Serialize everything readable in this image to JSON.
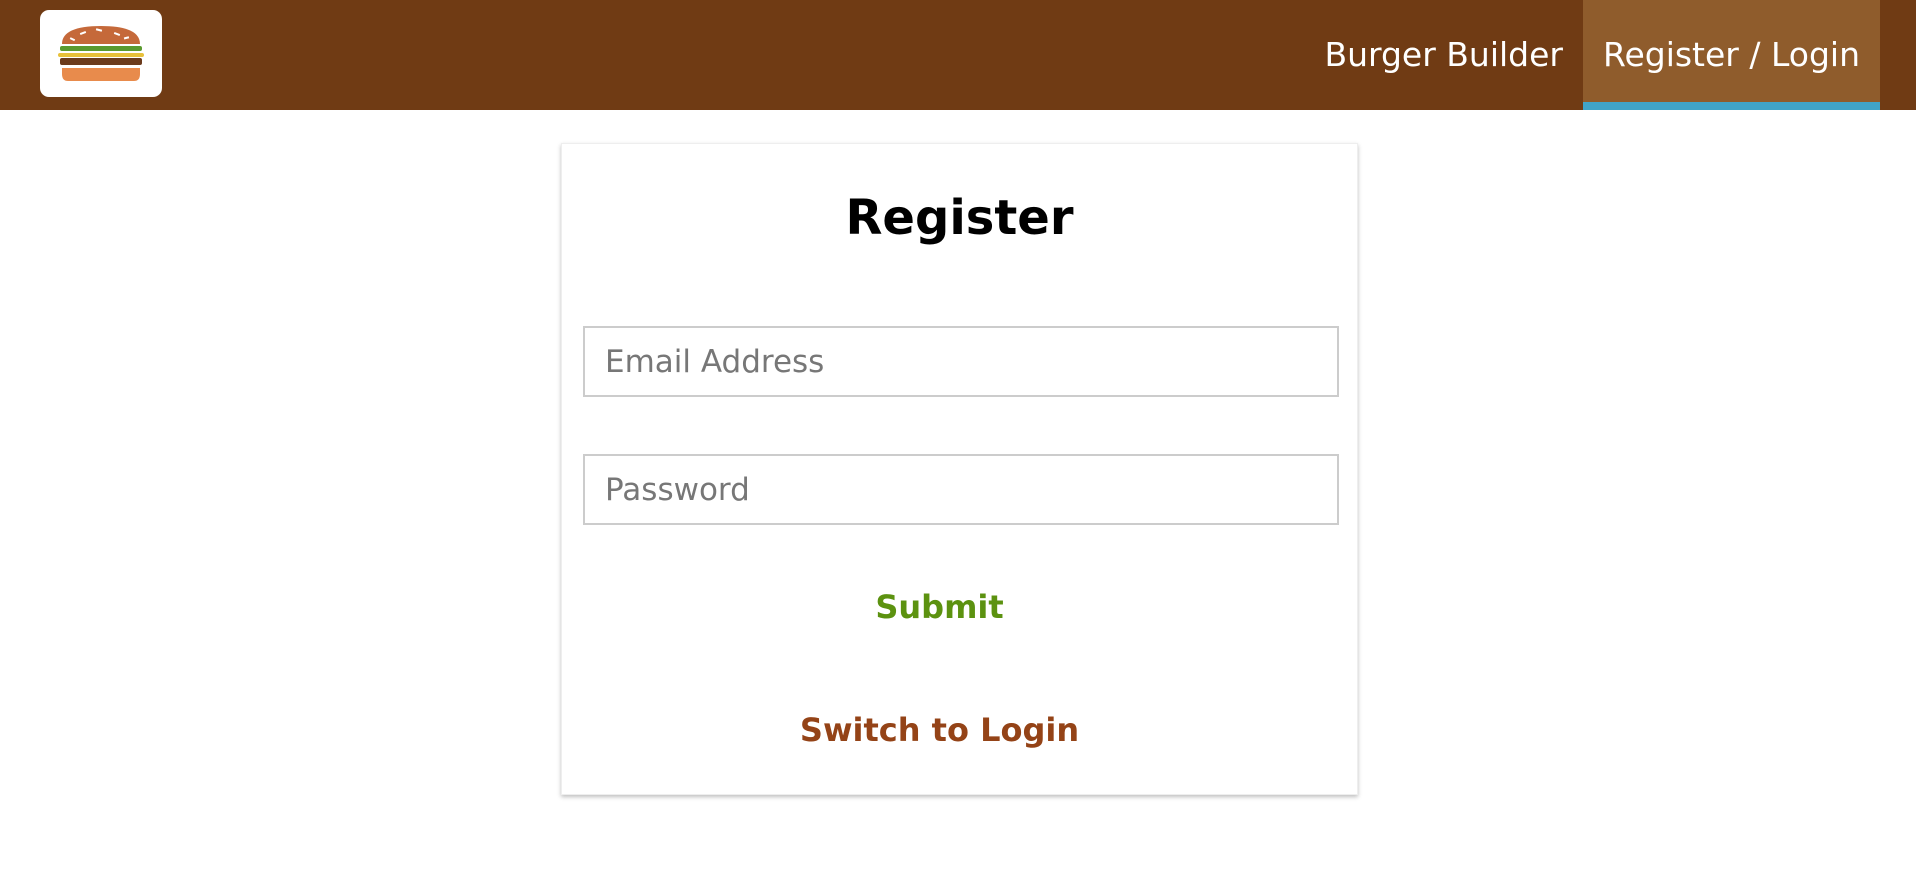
{
  "toolbar": {
    "logo_alt": "burger-logo",
    "nav": [
      {
        "label": "Burger Builder",
        "active": false
      },
      {
        "label": "Register / Login",
        "active": true
      }
    ]
  },
  "auth": {
    "title": "Register",
    "email_placeholder": "Email Address",
    "password_placeholder": "Password",
    "submit_label": "Submit",
    "switch_label": "Switch to Login"
  },
  "colors": {
    "toolbar_bg": "#703B14",
    "active_nav_bg": "#8F5C2C",
    "active_nav_underline": "#40A4C8",
    "submit_text": "#5C9210",
    "switch_text": "#944317"
  }
}
